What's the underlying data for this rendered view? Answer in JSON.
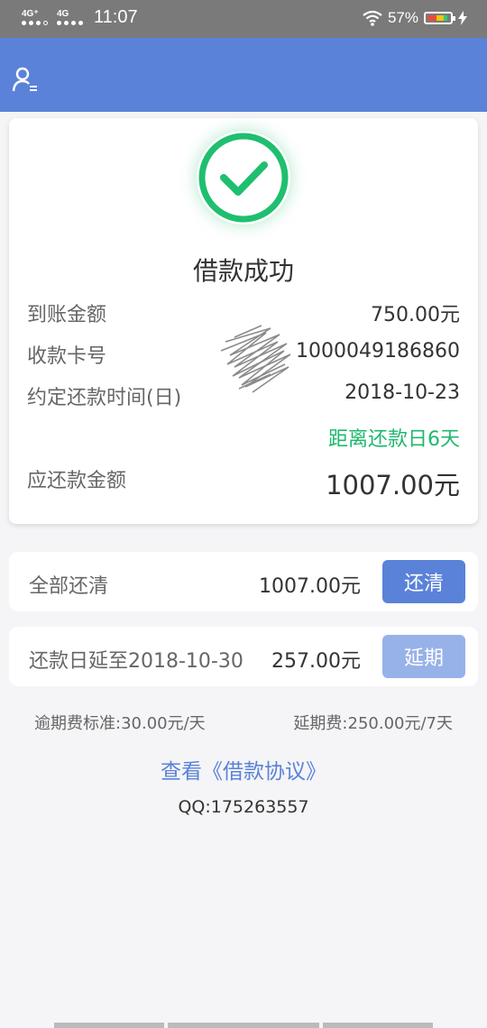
{
  "status_bar": {
    "sim1_network": "4G⁺",
    "sim2_network": "4G",
    "time": "11:07",
    "battery_percent": "57%"
  },
  "card": {
    "success_title": "借款成功",
    "rows": [
      {
        "label": "到账金额",
        "value": "750.00元"
      },
      {
        "label": "收款卡号",
        "value": "1000049186860"
      },
      {
        "label": "约定还款时间(日)",
        "value": "2018-10-23"
      }
    ],
    "countdown": "距离还款日6天",
    "due_label": "应还款金额",
    "due_amount": "1007.00元"
  },
  "repay_all": {
    "label": "全部还清",
    "amount": "1007.00元",
    "button": "还清"
  },
  "extend": {
    "label": "还款日延至2018-10-30",
    "amount": "257.00元",
    "button": "延期"
  },
  "fees": {
    "overdue": "逾期费标准:30.00元/天",
    "extension": "延期费:250.00元/7天"
  },
  "agreement_link": "查看《借款协议》",
  "qq": "QQ:175263557",
  "colors": {
    "primary": "#5a82d8",
    "success": "#1fb86f",
    "extend_button": "#97b2e8"
  }
}
